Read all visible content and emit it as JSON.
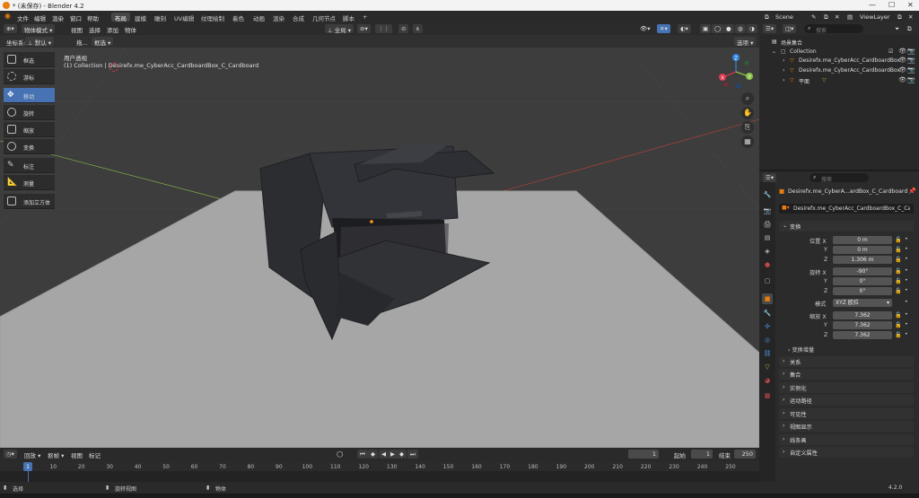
{
  "window": {
    "title": "* (未保存) - Blender 4.2"
  },
  "menu": [
    "文件",
    "编辑",
    "渲染",
    "窗口",
    "帮助"
  ],
  "workspaces": [
    "布局",
    "建模",
    "雕刻",
    "UV编辑",
    "纹理绘制",
    "着色",
    "动画",
    "渲染",
    "合成",
    "几何节点",
    "脚本"
  ],
  "workspace_add": "+",
  "scene": {
    "label": "Scene",
    "viewlayer": "ViewLayer"
  },
  "viewport_header": {
    "mode": "物体模式",
    "menus": [
      "视图",
      "选择",
      "添加",
      "物体"
    ],
    "transform_orientation_label": "坐标系:",
    "orientation_value": "默认",
    "drag_label": "拖...",
    "select_mode": "框选",
    "pivot": "全局",
    "options": "选项"
  },
  "toolbar": [
    "框选",
    "游标",
    "移动",
    "旋转",
    "缩放",
    "变换",
    "标注",
    "测量",
    "添加立方体"
  ],
  "viewport_info": {
    "line1": "用户透视",
    "line2": "(1) Collection | Desirefx.me_CyberAcc_CardboardBox_C_Cardboard"
  },
  "gizmo_axes": {
    "x": "X",
    "y": "Y",
    "z": "Z"
  },
  "outliner": {
    "search_placeholder": "搜索",
    "root": "场景集合",
    "items": [
      {
        "name": "Collection",
        "level": 1
      },
      {
        "name": "Desirefx.me_CyberAcc_CardboardBox",
        "level": 2
      },
      {
        "name": "Desirefx.me_CyberAcc_CardboardBox",
        "level": 2
      },
      {
        "name": "平面",
        "level": 2
      }
    ]
  },
  "properties": {
    "search_placeholder": "搜索",
    "object_name": "Desirefx.me_CyberA...ardBox_C_Cardboard",
    "object_field": "Desirefx.me_CyberAcc_CardboardBox_C_Ca...",
    "transform_header": "变换",
    "location_label": "位置 X",
    "location": [
      "0 m",
      "0 m",
      "1.306 m"
    ],
    "rotation_label": "旋转 X",
    "rotation": [
      "-90°",
      "0°",
      "0°"
    ],
    "mode_label": "模式",
    "mode_value": "XYZ 欧拉",
    "scale_label": "缩放 X",
    "scale": [
      "7.362",
      "7.362",
      "7.362"
    ],
    "axis_y": "Y",
    "axis_z": "Z",
    "delta": "变换增量",
    "sections": [
      "关系",
      "集合",
      "实例化",
      "运动路径",
      "可见性",
      "视图显示",
      "线条画",
      "自定义属性"
    ]
  },
  "timeline": {
    "menus": [
      "回放",
      "抠帧",
      "视图",
      "标记"
    ],
    "current_frame": "1",
    "start_label": "起始",
    "start": "1",
    "end_label": "结束",
    "end": "250",
    "ticks": [
      1,
      10,
      20,
      30,
      40,
      50,
      60,
      70,
      80,
      90,
      100,
      110,
      120,
      130,
      140,
      150,
      160,
      170,
      180,
      190,
      200,
      210,
      220,
      230,
      240,
      250
    ]
  },
  "status": {
    "select": "选择",
    "rotate": "旋转视图",
    "object": "物体",
    "version": "4.2.0"
  },
  "colors": {
    "active": "#4772b3",
    "grid": "#3d3d3d",
    "plane": "#a6a6a6",
    "x_axis": "#e4394f",
    "y_axis": "#8bc34a",
    "z_axis": "#2e86de"
  }
}
